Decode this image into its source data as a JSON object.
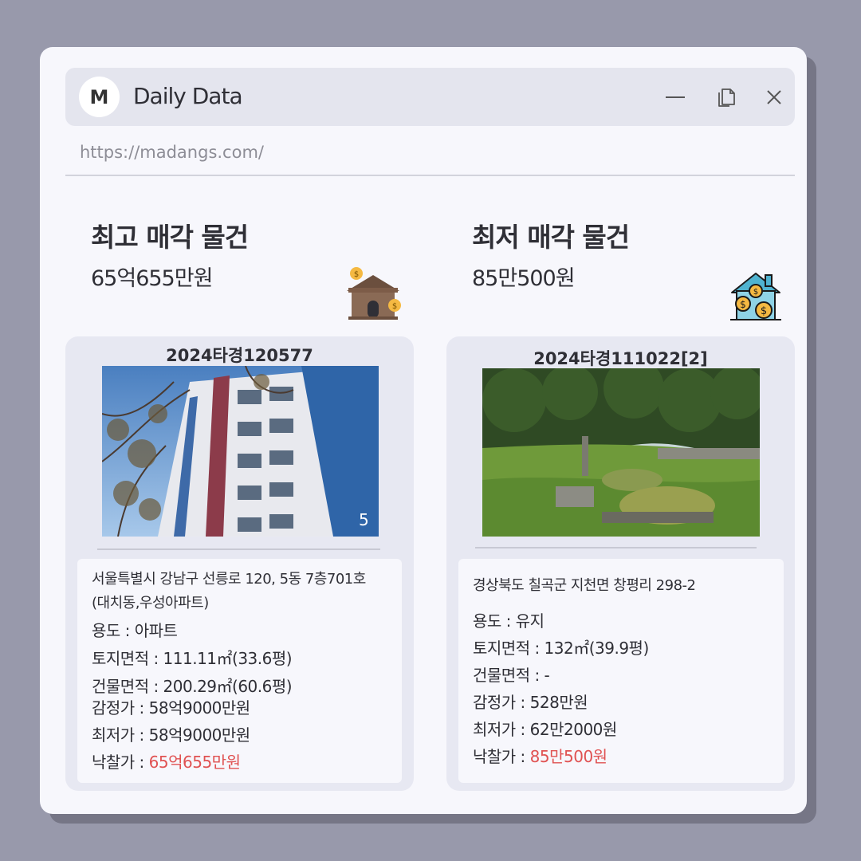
{
  "window": {
    "logo_letter": "M",
    "title": "Daily Data",
    "url": "https://madangs.com/"
  },
  "colors": {
    "accent_red": "#e05252",
    "background": "#9899ab",
    "panel": "#f7f7fc"
  },
  "icons": [
    "minimize-icon",
    "copy-icon",
    "close-icon",
    "house-coins-icon"
  ],
  "highest": {
    "heading": "최고 매각 물건",
    "amount": "65억655만원",
    "case_no": "2024타경120577",
    "address_line1": "서울특별시 강남구 선릉로 120, 5동 7층701호",
    "address_line2": "(대치동,우성아파트)",
    "usage": "용도 : 아파트",
    "land_area": "토지면적 : 111.11㎡(33.6평)",
    "building_area": "건물면적 : 200.29㎡(60.6평)",
    "appraisal": "감정가 : 58억9000만원",
    "minimum": "최저가 : 58억9000만원",
    "winning_label": "낙찰가 : ",
    "winning_value": "65억655만원"
  },
  "lowest": {
    "heading": "최저 매각 물건",
    "amount": "85만500원",
    "case_no": "2024타경111022[2]",
    "address_line1": "경상북도 칠곡군 지천면 창평리 298-2",
    "usage": "용도 : 유지",
    "land_area": "토지면적 : 132㎡(39.9평)",
    "building_area": "건물면적 : -",
    "appraisal": "감정가 : 528만원",
    "minimum": "최저가 : 62만2000원",
    "winning_label": "낙찰가 : ",
    "winning_value": "85만500원"
  }
}
